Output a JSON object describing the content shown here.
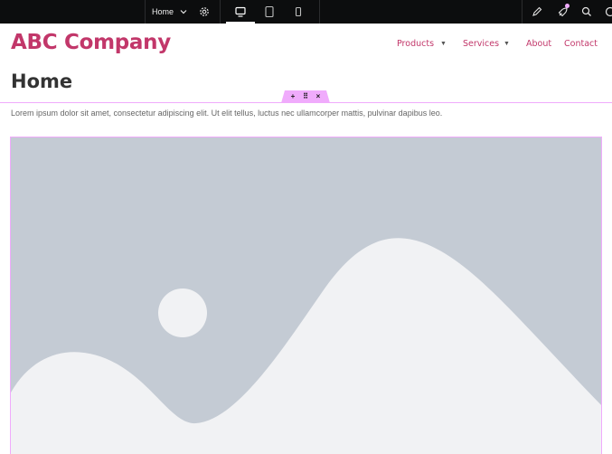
{
  "toolbar": {
    "page_name": "Home",
    "icons": [
      "chevron-down-icon",
      "gear-icon",
      "desktop-icon",
      "tablet-icon",
      "mobile-icon",
      "edit-icon",
      "launch-icon",
      "search-icon",
      "help-icon"
    ]
  },
  "site": {
    "logo": "ABC Company",
    "nav": {
      "products": "Products",
      "services": "Services",
      "about": "About",
      "contact": "Contact",
      "caret": "▼"
    }
  },
  "page": {
    "title": "Home",
    "paragraph": "Lorem ipsum dolor sit amet, consectetur adipiscing elit. Ut elit tellus, luctus nec ullamcorper mattis, pulvinar dapibus leo."
  },
  "section_handle": {
    "add": "+",
    "move": "⠿",
    "close": "×"
  },
  "colors": {
    "brand": "#c2376a",
    "selection": "#f0abfc",
    "toolbar_bg": "#0c0d0e",
    "placeholder_bg": "#c4cbd4",
    "placeholder_fg": "#f1f2f4"
  }
}
